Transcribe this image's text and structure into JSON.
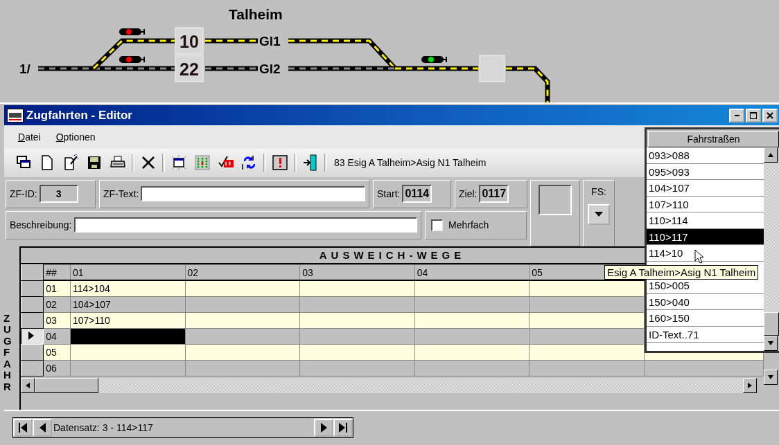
{
  "diagram": {
    "station": "Talheim",
    "entry_label": "1/",
    "tracks": [
      {
        "number": "10",
        "name": "Gl1"
      },
      {
        "number": "22",
        "name": "Gl2"
      }
    ],
    "signals": [
      {
        "color": "#ff0000"
      },
      {
        "color": "#ff0000"
      },
      {
        "color": "#00e000"
      }
    ]
  },
  "window": {
    "title": "Zugfahrten - Editor"
  },
  "menu": [
    "Datei",
    "Optionen"
  ],
  "toolbar": {
    "buttons": [
      {
        "kind": "windows"
      },
      {
        "kind": "new"
      },
      {
        "kind": "wand"
      },
      {
        "kind": "save"
      },
      {
        "kind": "print"
      },
      {
        "kind": "sep"
      },
      {
        "kind": "delete"
      },
      {
        "kind": "sep"
      },
      {
        "kind": "frame"
      },
      {
        "kind": "grid"
      },
      {
        "kind": "check"
      },
      {
        "kind": "swap"
      },
      {
        "kind": "sep"
      },
      {
        "kind": "alert"
      },
      {
        "kind": "sep"
      },
      {
        "kind": "exit"
      },
      {
        "kind": "sep"
      }
    ],
    "route": "83 Esig A Talheim>Asig N1 Talheim"
  },
  "form": {
    "zf_id": {
      "label": "ZF-ID:",
      "value": "3"
    },
    "zf_text": {
      "label": "ZF-Text:"
    },
    "start": {
      "label": "Start:",
      "value": "0114"
    },
    "ziel": {
      "label": "Ziel:",
      "value": "0117"
    },
    "fs": {
      "label": "FS:"
    },
    "beschreibung": {
      "label": "Beschreibung:"
    },
    "mehrfach": {
      "label": "Mehrfach",
      "checked": false
    }
  },
  "grid": {
    "title": "AUSWEICH-WEGE",
    "side_label": "ZUGFAHR",
    "columns": [
      "##",
      "01",
      "02",
      "03",
      "04",
      "05"
    ],
    "rows": [
      {
        "cells": [
          "01",
          "114>104"
        ],
        "selected": false
      },
      {
        "cells": [
          "02",
          "104>107"
        ],
        "selected": false
      },
      {
        "cells": [
          "03",
          "107>110"
        ],
        "selected": false
      },
      {
        "cells": [
          "04"
        ],
        "selected": true
      },
      {
        "cells": [
          "05"
        ],
        "selected": false
      },
      {
        "cells": [
          "06"
        ],
        "selected": false
      }
    ]
  },
  "navigator": {
    "record": "Datensatz: 3 - 114>117"
  },
  "routes_list": {
    "header": "Fahrstraßen",
    "items": [
      {
        "text": "093>088",
        "selected": false
      },
      {
        "text": "095>093",
        "selected": false
      },
      {
        "text": "104>107",
        "selected": false
      },
      {
        "text": "107>110",
        "selected": false
      },
      {
        "text": "110>114",
        "selected": false
      },
      {
        "text": "110>117",
        "selected": true
      },
      {
        "text": "114>10",
        "selected": false
      },
      {
        "text": "150>005",
        "selected": false
      },
      {
        "text": "150>040",
        "selected": false
      },
      {
        "text": "160>150",
        "selected": false
      },
      {
        "text": "ID-Text..71",
        "selected": false
      }
    ]
  },
  "tooltip": "Esig A Talheim>Asig N1 Talheim"
}
